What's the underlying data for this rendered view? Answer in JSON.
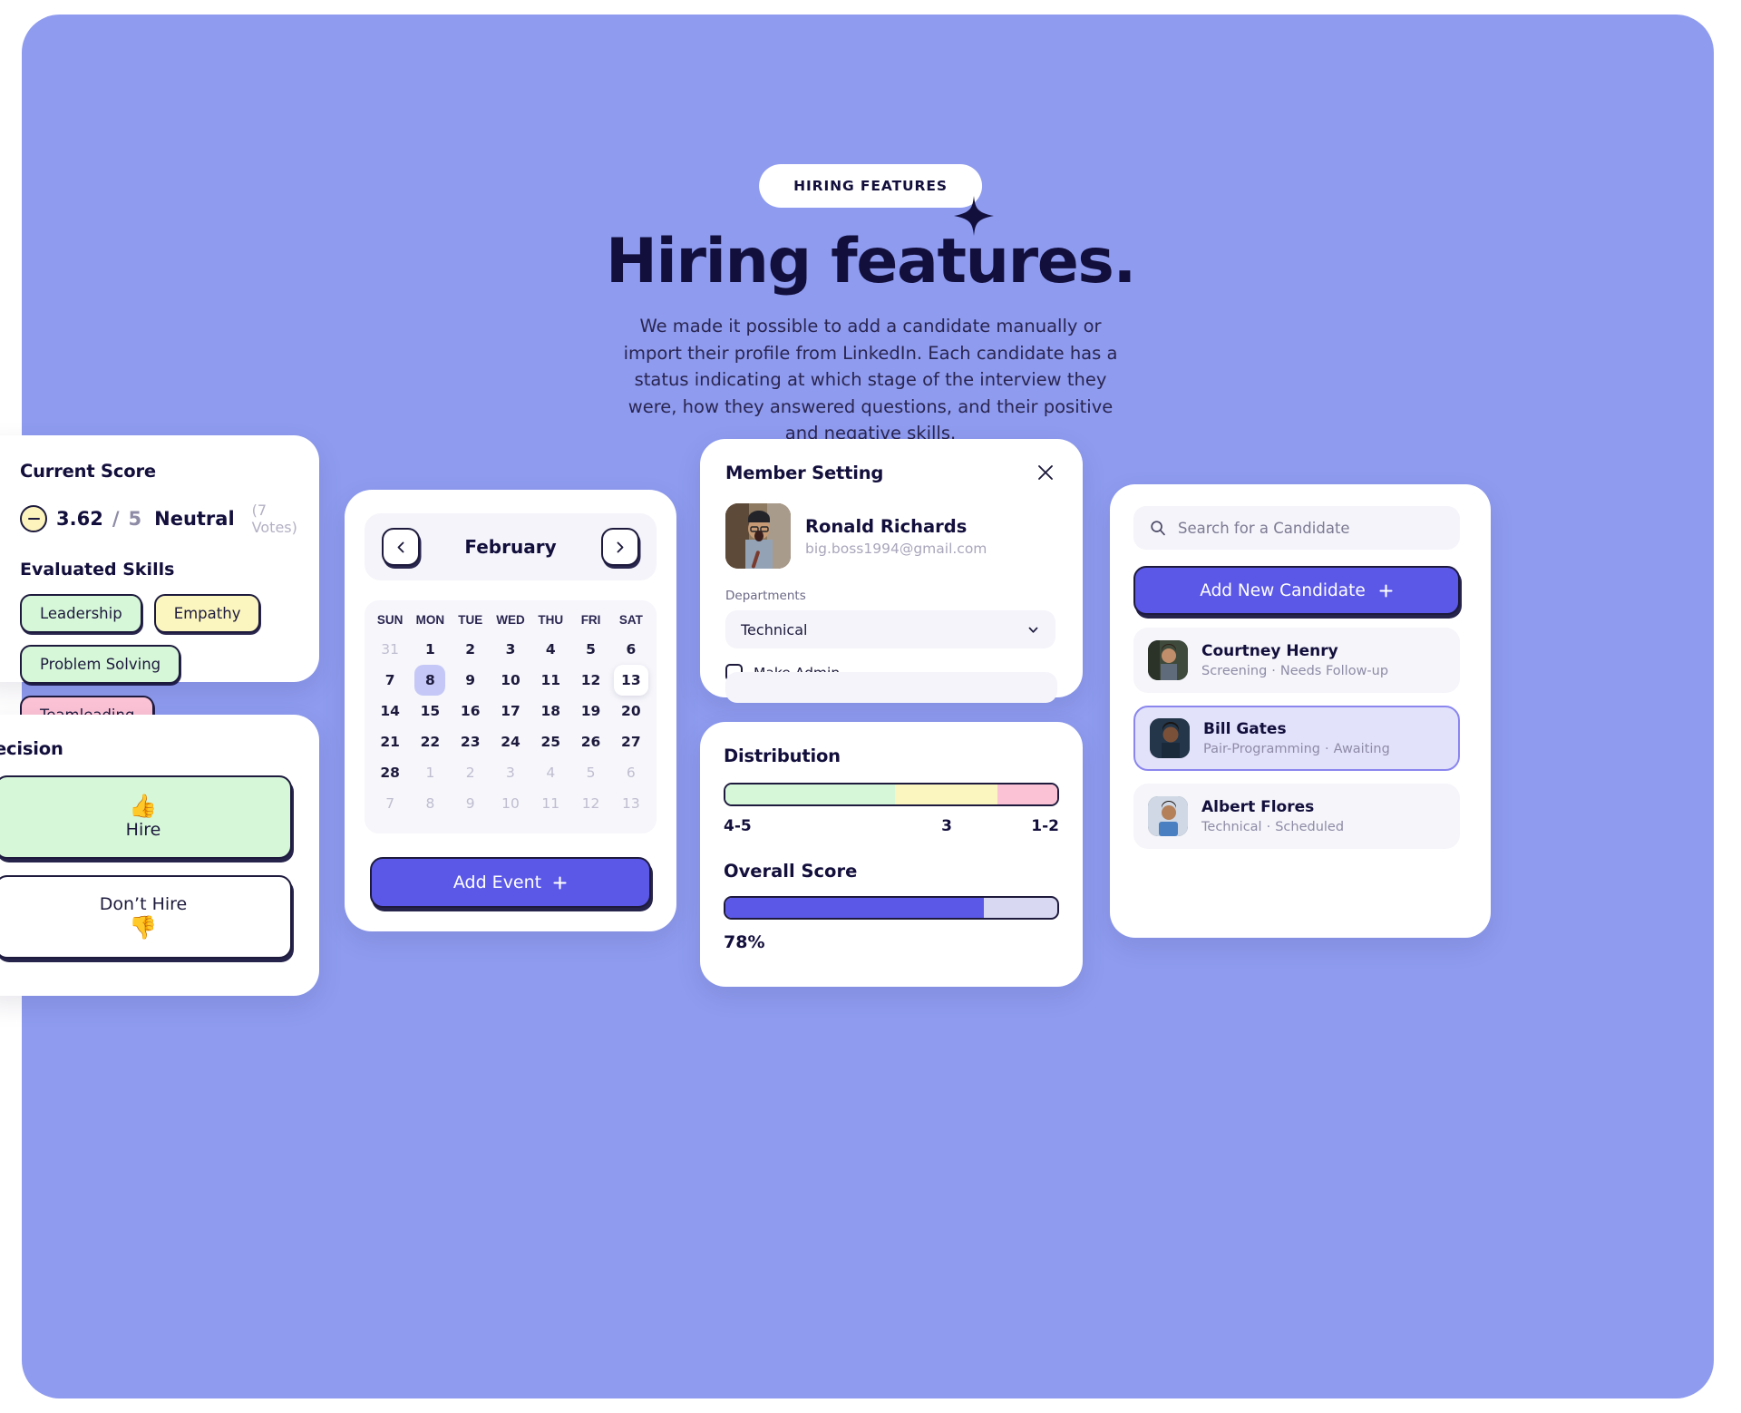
{
  "hero": {
    "badge": "HIRING FEATURES",
    "title": "Hiring features.",
    "description": "We made it possible to add a candidate manually or import their profile from LinkedIn. Each candidate has a status indicating at which stage of the interview they were, how they answered questions, and their positive and negative skills.",
    "sparkle_icon": "sparkle-icon"
  },
  "colors": {
    "background": "#8e9bef",
    "accent": "#5b58e8",
    "ink": "#130f3c",
    "green": "#d6f7d8",
    "yellow": "#fbf5bf",
    "pink": "#fbc2d5"
  },
  "score_card": {
    "title": "Current Score",
    "icon": "neutral-minus-icon",
    "value": "3.62",
    "separator": "/",
    "max": "5",
    "sentiment": "Neutral",
    "votes": "(7 Votes)",
    "skills_title": "Evaluated Skills",
    "skills": [
      {
        "label": "Leadership",
        "tone": "green"
      },
      {
        "label": "Empathy",
        "tone": "yellow"
      },
      {
        "label": "Problem Solving",
        "tone": "green"
      },
      {
        "label": "Teamleading",
        "tone": "pink"
      }
    ]
  },
  "decision_card": {
    "title": "ecision",
    "hire_label": "Hire",
    "hire_icon": "thumbs-up-icon",
    "no_hire_label": "Don’t Hire",
    "no_hire_icon": "thumbs-down-icon"
  },
  "calendar_card": {
    "month": "February",
    "prev_icon": "chevron-left-icon",
    "next_icon": "chevron-right-icon",
    "day_headers": [
      "SUN",
      "MON",
      "TUE",
      "WED",
      "THU",
      "FRI",
      "SAT"
    ],
    "weeks": [
      [
        {
          "d": "31",
          "state": "muted"
        },
        {
          "d": "1",
          "state": "normal"
        },
        {
          "d": "2",
          "state": "normal"
        },
        {
          "d": "3",
          "state": "normal"
        },
        {
          "d": "4",
          "state": "normal"
        },
        {
          "d": "5",
          "state": "normal"
        },
        {
          "d": "6",
          "state": "normal"
        }
      ],
      [
        {
          "d": "7",
          "state": "normal"
        },
        {
          "d": "8",
          "state": "sel"
        },
        {
          "d": "9",
          "state": "normal"
        },
        {
          "d": "10",
          "state": "normal"
        },
        {
          "d": "11",
          "state": "normal"
        },
        {
          "d": "12",
          "state": "normal"
        },
        {
          "d": "13",
          "state": "today"
        }
      ],
      [
        {
          "d": "14",
          "state": "normal"
        },
        {
          "d": "15",
          "state": "normal"
        },
        {
          "d": "16",
          "state": "normal"
        },
        {
          "d": "17",
          "state": "normal"
        },
        {
          "d": "18",
          "state": "normal"
        },
        {
          "d": "19",
          "state": "normal"
        },
        {
          "d": "20",
          "state": "normal"
        }
      ],
      [
        {
          "d": "21",
          "state": "normal"
        },
        {
          "d": "22",
          "state": "normal"
        },
        {
          "d": "23",
          "state": "normal"
        },
        {
          "d": "24",
          "state": "normal"
        },
        {
          "d": "25",
          "state": "normal"
        },
        {
          "d": "26",
          "state": "normal"
        },
        {
          "d": "27",
          "state": "normal"
        }
      ],
      [
        {
          "d": "28",
          "state": "normal"
        },
        {
          "d": "1",
          "state": "muted"
        },
        {
          "d": "2",
          "state": "muted"
        },
        {
          "d": "3",
          "state": "muted"
        },
        {
          "d": "4",
          "state": "muted"
        },
        {
          "d": "5",
          "state": "muted"
        },
        {
          "d": "6",
          "state": "muted"
        }
      ],
      [
        {
          "d": "7",
          "state": "muted"
        },
        {
          "d": "8",
          "state": "muted"
        },
        {
          "d": "9",
          "state": "muted"
        },
        {
          "d": "10",
          "state": "muted"
        },
        {
          "d": "11",
          "state": "muted"
        },
        {
          "d": "12",
          "state": "muted"
        },
        {
          "d": "13",
          "state": "muted"
        }
      ]
    ],
    "cta_label": "Add Event",
    "cta_icon": "plus-icon"
  },
  "member_card": {
    "title": "Member Setting",
    "close_icon": "close-icon",
    "avatar": "member-avatar",
    "name": "Ronald Richards",
    "email": "big.boss1994@gmail.com",
    "departments_label": "Departments",
    "department_value": "Technical",
    "dropdown_icon": "chevron-down-icon",
    "make_admin_label": "Make Admin",
    "make_admin_checked": false
  },
  "distribution_card": {
    "title": "Distribution",
    "segments": [
      {
        "label": "4-5",
        "color": "#d6f7d8",
        "width_pct": 51
      },
      {
        "label": "3",
        "color": "#fbf5bf",
        "width_pct": 31
      },
      {
        "label": "1-2",
        "color": "#fbc2d5",
        "width_pct": 18
      }
    ],
    "overall_title": "Overall Score",
    "overall_pct_label": "78%",
    "overall_pct": 78
  },
  "candidates_card": {
    "search_placeholder": "Search for a Candidate",
    "search_icon": "search-icon",
    "add_label": "Add New Candidate",
    "add_icon": "plus-icon",
    "rows": [
      {
        "name": "Courtney Henry",
        "stage": "Screening",
        "status": "Needs Follow-up",
        "active": false
      },
      {
        "name": "Bill Gates",
        "stage": "Pair-Programming",
        "status": "Awaiting",
        "active": true
      },
      {
        "name": "Albert Flores",
        "stage": "Technical",
        "status": "Scheduled",
        "active": false
      }
    ]
  }
}
